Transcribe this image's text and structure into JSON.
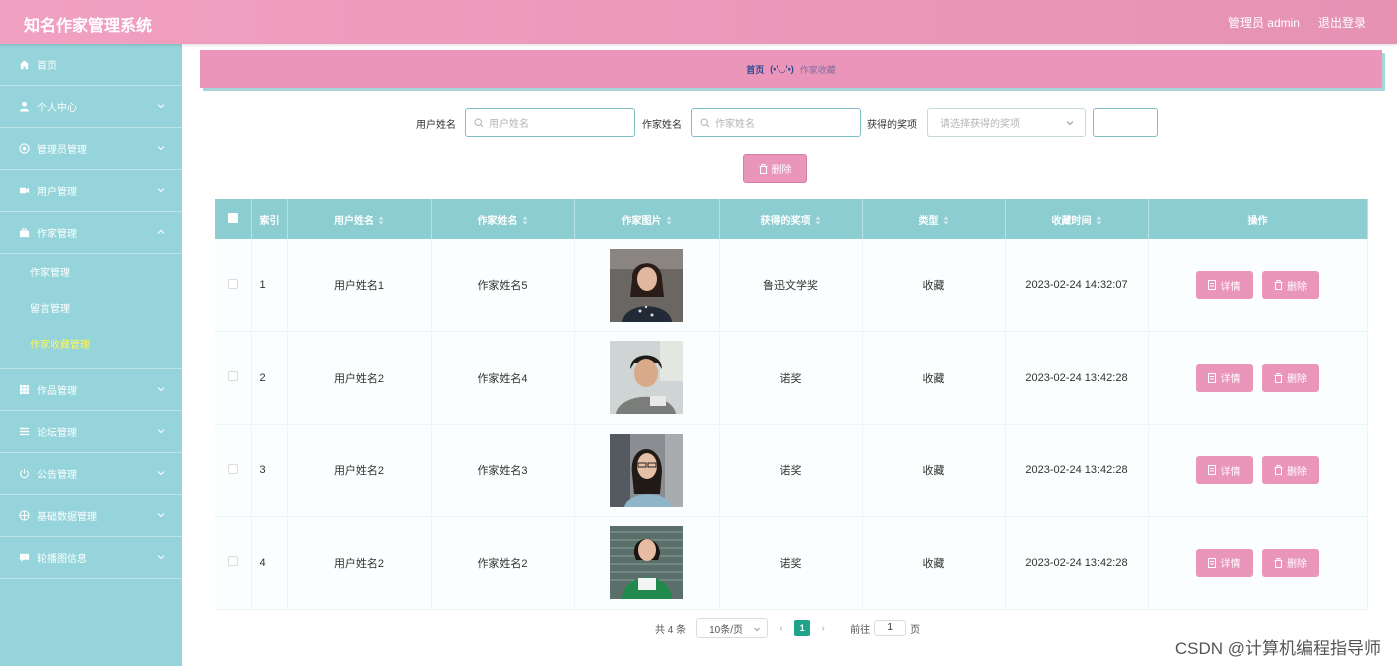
{
  "header": {
    "title": "知名作家管理系统",
    "user_label": "管理员 admin",
    "logout": "退出登录"
  },
  "sidebar": {
    "items": [
      {
        "label": "首页",
        "icon": "home-icon"
      },
      {
        "label": "个人中心",
        "icon": "user-icon"
      },
      {
        "label": "管理员管理",
        "icon": "admin-icon"
      },
      {
        "label": "用户管理",
        "icon": "users-icon"
      },
      {
        "label": "作家管理",
        "icon": "briefcase-icon",
        "expanded": true,
        "children": [
          "作家管理",
          "留言管理",
          "作家收藏管理"
        ],
        "active_child": "作家收藏管理"
      },
      {
        "label": "作品管理",
        "icon": "grid-icon"
      },
      {
        "label": "论坛管理",
        "icon": "menu-icon"
      },
      {
        "label": "公告管理",
        "icon": "power-icon"
      },
      {
        "label": "基础数据管理",
        "icon": "globe-icon"
      },
      {
        "label": "轮播图信息",
        "icon": "chat-icon"
      }
    ]
  },
  "breadcrumb": {
    "home": "首页",
    "separator": "(•'◡'•)",
    "current": "作家收藏"
  },
  "search": {
    "user_label": "用户姓名",
    "user_placeholder": "用户姓名",
    "writer_label": "作家姓名",
    "writer_placeholder": "作家姓名",
    "award_label": "获得的奖项",
    "award_placeholder": "请选择获得的奖项"
  },
  "delete_button": "删除",
  "table": {
    "columns": [
      "索引",
      "用户姓名",
      "作家姓名",
      "作家图片",
      "获得的奖项",
      "类型",
      "收藏时间",
      "操作"
    ],
    "rows": [
      {
        "index": "1",
        "user": "用户姓名1",
        "writer": "作家姓名5",
        "award": "鲁迅文学奖",
        "type": "收藏",
        "time": "2023-02-24 14:32:07"
      },
      {
        "index": "2",
        "user": "用户姓名2",
        "writer": "作家姓名4",
        "award": "诺奖",
        "type": "收藏",
        "time": "2023-02-24 13:42:28"
      },
      {
        "index": "3",
        "user": "用户姓名2",
        "writer": "作家姓名3",
        "award": "诺奖",
        "type": "收藏",
        "time": "2023-02-24 13:42:28"
      },
      {
        "index": "4",
        "user": "用户姓名2",
        "writer": "作家姓名2",
        "award": "诺奖",
        "type": "收藏",
        "time": "2023-02-24 13:42:28"
      }
    ],
    "detail_label": "详情",
    "delete_label": "删除"
  },
  "pagination": {
    "total": "共 4 条",
    "page_size": "10条/页",
    "current": "1",
    "goto_label": "前往",
    "goto_value": "1",
    "page_suffix": "页"
  },
  "watermark": "CSDN @计算机编程指导师",
  "colors": {
    "header": "#e996ba",
    "sidebar": "#94d4da",
    "table_header": "#8ccdd1",
    "button": "#e996ba",
    "active_submenu": "#fff45a",
    "pager_active": "#1fa389"
  }
}
